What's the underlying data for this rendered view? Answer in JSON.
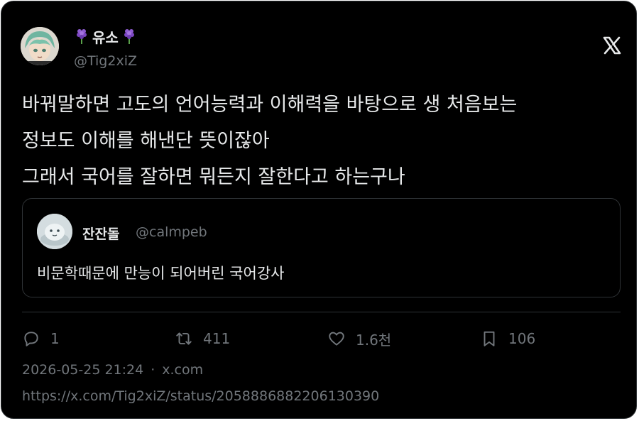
{
  "author": {
    "display_name": "유소",
    "handle": "@Tig2xiZ",
    "name_emoji": "hyacinth-emoji"
  },
  "brand_icon": "x-logo-icon",
  "tweet": {
    "lines": [
      "바꿔말하면 고도의 언어능력과 이해력을 바탕으로 생 처음보는",
      "정보도 이해를 해낸단 뜻이잖아",
      "그래서 국어를 잘하면 뭐든지 잘한다고 하는구나"
    ]
  },
  "quote": {
    "display_name": "잔잔돌",
    "handle": "@calmpeb",
    "text": "비문학때문에 만능이 되어버린 국어강사"
  },
  "actions": {
    "reply": {
      "icon": "reply-icon",
      "count": "1"
    },
    "retweet": {
      "icon": "retweet-icon",
      "count": "411"
    },
    "like": {
      "icon": "heart-icon",
      "count": "1.6천"
    },
    "bookmark": {
      "icon": "bookmark-icon",
      "count": "106"
    }
  },
  "meta": {
    "datetime": "2026-05-25 21:24",
    "separator": "·",
    "source": "x.com"
  },
  "status_url": "https://x.com/Tig2xiZ/status/2058886882206130390",
  "colors": {
    "background": "#000000",
    "text": "#e7e9ea",
    "muted": "#71767b",
    "border": "#2f3336"
  }
}
